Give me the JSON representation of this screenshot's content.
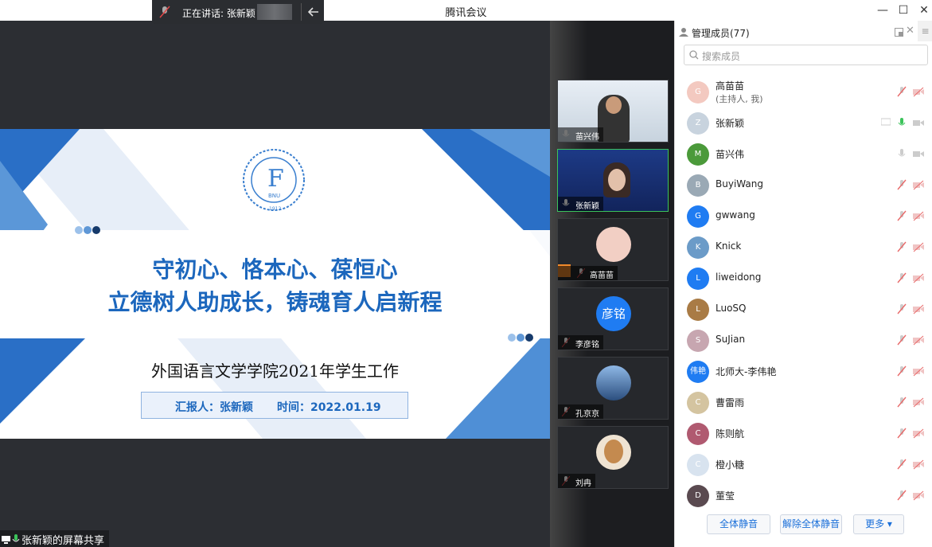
{
  "window": {
    "title": "腾讯会议",
    "minimize": "—",
    "maximize": "☐",
    "close": "✕"
  },
  "speaking": {
    "label": "正在讲话: 张新颖"
  },
  "share": {
    "label": "张新颖的屏幕共享"
  },
  "slide": {
    "title_line1": "守初心、恪本心、葆恒心",
    "title_line2": "立德树人助成长，铸魂育人启新程",
    "subtitle": "外国语言文学学院2021年学生工作",
    "reporter": "汇报人：张新颖",
    "time": "时间：2022.01.19",
    "logo_text": "BNU",
    "logo_year": "1912"
  },
  "videos": [
    {
      "name": "苗兴伟"
    },
    {
      "name": "张新颖"
    },
    {
      "name": "高苗苗"
    },
    {
      "name": "李彦铭",
      "avatar_text": "彦铭"
    },
    {
      "name": "孔京京"
    },
    {
      "name": "刘冉"
    }
  ],
  "panel": {
    "title": "管理成员(77)",
    "search_placeholder": "搜索成员",
    "members": [
      {
        "name": "高苗苗",
        "sub": "(主持人, 我)",
        "avatar": "G",
        "color": "#f3c9c0"
      },
      {
        "name": "张新颖",
        "avatar": "Z",
        "color": "#c8d3de"
      },
      {
        "name": "苗兴伟",
        "avatar": "M",
        "color": "#4b9a3a"
      },
      {
        "name": "BuyiWang",
        "avatar": "B",
        "color": "#9aa9b5"
      },
      {
        "name": "gwwang",
        "avatar": "G",
        "color": "#1f7cf2"
      },
      {
        "name": "Knick",
        "avatar": "K",
        "color": "#6b9bc8"
      },
      {
        "name": "liweidong",
        "avatar": "L",
        "color": "#1f7cf2"
      },
      {
        "name": "LuoSQ",
        "avatar": "L",
        "color": "#a97b45"
      },
      {
        "name": "SuJian",
        "avatar": "S",
        "color": "#c7a6b0"
      },
      {
        "name": "北师大-李伟艳",
        "avatar": "伟艳",
        "color": "#1f7cf2"
      },
      {
        "name": "曹雷雨",
        "avatar": "C",
        "color": "#d4c4a0"
      },
      {
        "name": "陈则航",
        "avatar": "C",
        "color": "#b05a70"
      },
      {
        "name": "橙小糖",
        "avatar": "C",
        "color": "#d8e3ef"
      },
      {
        "name": "董莹",
        "avatar": "D",
        "color": "#5a4a50"
      }
    ],
    "mute_all": "全体静音",
    "unmute_all": "解除全体静音",
    "more": "更多 ▾"
  }
}
